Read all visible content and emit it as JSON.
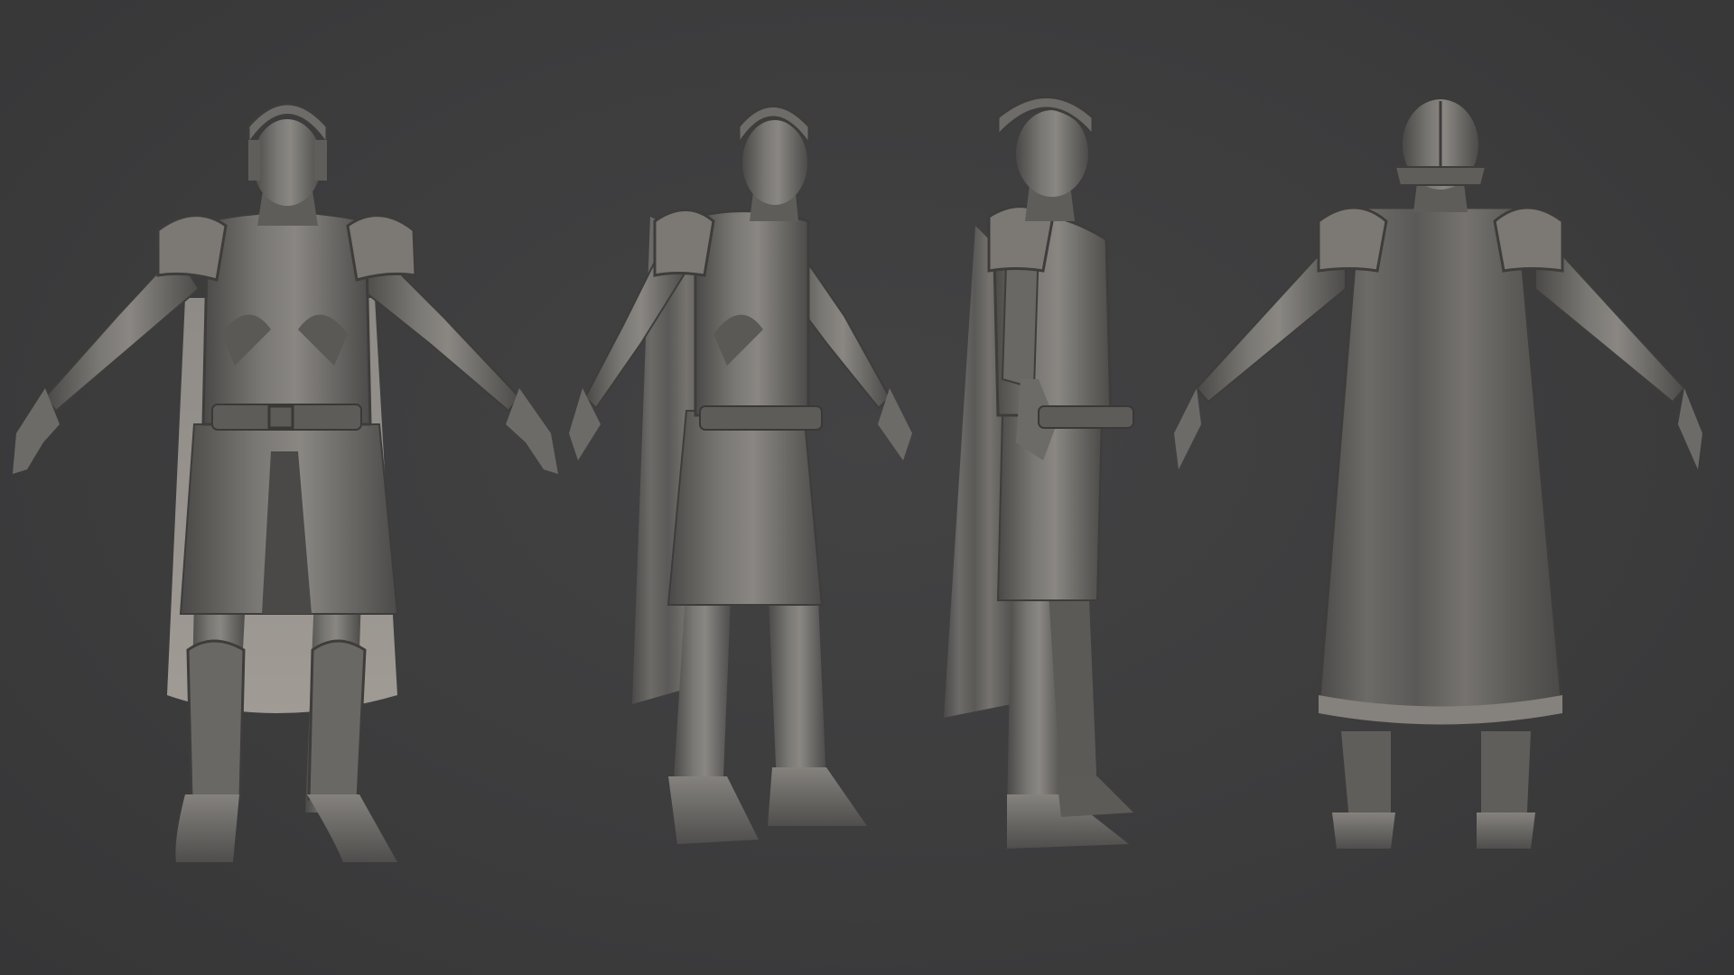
{
  "scene": {
    "background_color": "#3d3d3e",
    "material_color": "#6f6d6b",
    "material_shadow": "#3f3e3d",
    "material_highlight": "#a19e9a",
    "views": [
      "front",
      "three-quarter",
      "side",
      "back"
    ]
  }
}
